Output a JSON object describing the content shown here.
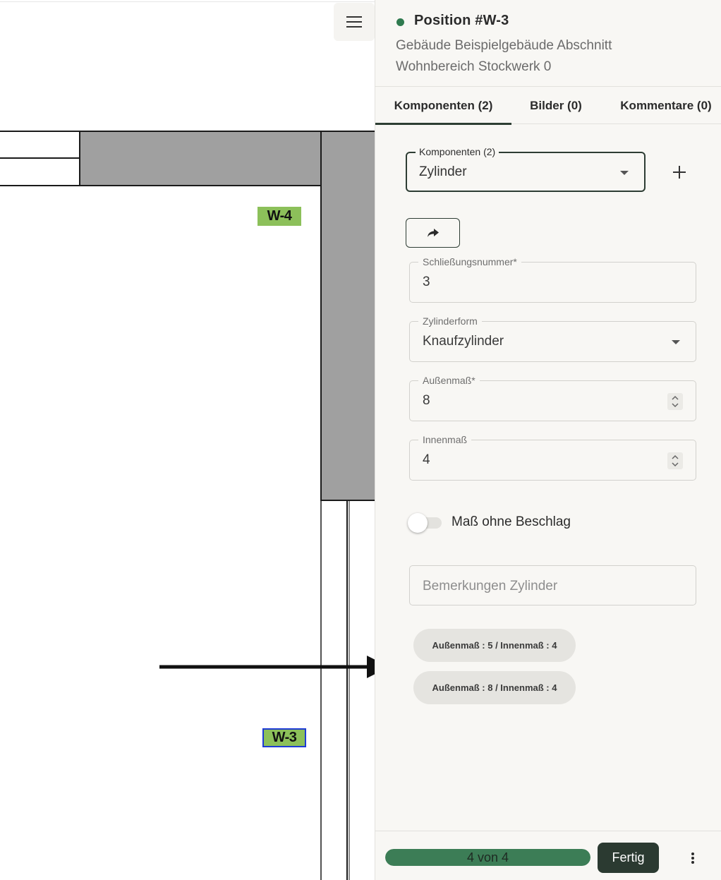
{
  "plan": {
    "labels": {
      "w4": "W-4",
      "w3": "W-3"
    },
    "colors": {
      "wall": "#a0a0a0",
      "room_label_bg": "#8cc05a",
      "selected_border": "#1d3ad6"
    },
    "menu_icon": "hamburger-icon"
  },
  "header": {
    "title": "Position #W-3",
    "status_color": "#2f7a4f",
    "location": "Gebäude Beispielgebäude Abschnitt Wohnbereich Stockwerk 0"
  },
  "tabs": [
    {
      "label": "Komponenten (2)",
      "active": true
    },
    {
      "label": "Bilder (0)",
      "active": false
    },
    {
      "label": "Kommentare (0)",
      "active": false
    }
  ],
  "component_select": {
    "label": "Komponenten (2)",
    "value": "Zylinder"
  },
  "icons": {
    "add": "plus-icon",
    "share": "share-arrow-icon",
    "more": "more-vertical-icon"
  },
  "fields": {
    "schliessungsnummer": {
      "label": "Schließungsnummer*",
      "value": "3"
    },
    "zylinderform": {
      "label": "Zylinderform",
      "value": "Knaufzylinder"
    },
    "aussenmass": {
      "label": "Außenmaß*",
      "value": "8"
    },
    "innenmass": {
      "label": "Innenmaß",
      "value": "4"
    }
  },
  "toggle": {
    "label": "Maß ohne Beschlag",
    "on": false
  },
  "remarks": {
    "placeholder": "Bemerkungen Zylinder"
  },
  "suggestions": [
    "Außenmaß : 5 / Innenmaß : 4",
    "Außenmaß : 8 / Innenmaß : 4"
  ],
  "footer": {
    "progress_text": "4 von 4",
    "progress_fraction": 1.0,
    "progress_color": "#3c7d56",
    "done_label": "Fertig"
  }
}
